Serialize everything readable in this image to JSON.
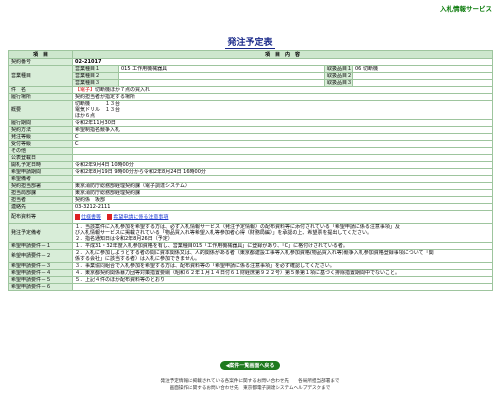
{
  "header": {
    "service_name": "入札情報サービス"
  },
  "page_title": "発注予定表",
  "table_header": {
    "item": "項　目",
    "content": "項　目　内　容"
  },
  "rows": {
    "contract_no": {
      "label": "契約番号",
      "value": "02-21017"
    },
    "business_type": {
      "label": "営業種目",
      "sub1_label": "営業種目１",
      "sub1_value": "015 工作用機械器具",
      "sub2_label": "営業種目２",
      "sub2_value": "",
      "sub3_label": "営業種目３",
      "sub3_value": "",
      "item1_label": "取扱品目１",
      "item1_value": "06 切断機",
      "item2_label": "取扱品目２",
      "item2_value": "",
      "item3_label": "取扱品目３",
      "item3_value": ""
    },
    "subject": {
      "label": "件　名",
      "tag": "【電子】",
      "value": "切断機ほか７点の買入れ"
    },
    "delivery_place": {
      "label": "履行場所",
      "value": "契約担当者が指定する場所"
    },
    "summary": {
      "label": "概要",
      "lines": [
        "切断機　　　１３台",
        "電気ドリル　１３台",
        "ほか６点"
      ]
    },
    "scheduled_date": {
      "label": "履行期間",
      "value": "令和2年11月30日"
    },
    "contract_method": {
      "label": "契約方法",
      "value": "希望制指名競争入札"
    },
    "dev_grade": {
      "label": "発注等級",
      "value": "C"
    },
    "accept_grade": {
      "label": "受付等級",
      "value": "C"
    },
    "other": {
      "label": "その他",
      "value": ""
    },
    "registration_date": {
      "label": "公表登載日",
      "value": ""
    },
    "opening_date": {
      "label": "開札予定日時",
      "value": "令和2年9月4日 10時00分"
    },
    "apply_period": {
      "label": "希望申請期間",
      "value": "令和2年8月19日 9時00分から令和2年8月24日 16時00分"
    },
    "bid_remarks": {
      "label": "希望備考",
      "value": ""
    },
    "contract_dept": {
      "label": "契約担当部署",
      "value": "東京消防庁総務部経理契約課（電子調達システム）"
    },
    "charge_dept": {
      "label": "担当局部課",
      "value": "東京消防庁総務部経理契約課"
    },
    "person": {
      "label": "担当者",
      "value": "契約係　坂部"
    },
    "contact": {
      "label": "連絡先",
      "value": "03-3212-2111"
    },
    "docs": {
      "label": "配布資料等",
      "link1": "仕様書等",
      "link2": "希望申請に係る注意事項"
    },
    "order_notes": {
      "label": "発注予定備考",
      "lines": [
        "１．当該案件に入札参加を希望する方は、必ず入札情報サービス（発注予定情報）の配布資料等に添付されている「希望申請に係る注意事項」及",
        "び入札情報サービスに掲載されている「物品買入れ等希望入札等参加者心得（財務局編）」を承認の上、希望票を提出してください。",
        "２．指名通知日は令和2年8月26日（予定）"
      ]
    },
    "cond1": {
      "label": "希望申請要件－１",
      "value": "１．平成31・32年度入札参加資格を有し、営業種目015「工作用機械器具」に登録があり、「C」に格付けされている者。"
    },
    "cond2": {
      "label": "希望申請要件－２",
      "lines": [
        "２．入札に参加しようとする者の間に資本関係又は、人的関係がある者（東京都建設工事等入札参加資格(物品買入れ等)競争入札参加資格登録事項について「関",
        "係する会社」に該当する者）は入札に参加できません。"
      ]
    },
    "cond3": {
      "label": "希望申請要件－３",
      "value": "３．事業協同組合で入札参加を希望する方は、配布資料等の「希望申請に係る注意事項」を必ず確認してください。"
    },
    "cond4": {
      "label": "希望申請要件－４",
      "value": "４．東京都契約関係暴力団等対策措置要綱（昭和６２年１月１４日付６１財経庶第９２２号）第５条第１項に基づく排除措置期間中でないこと。"
    },
    "cond5": {
      "label": "希望申請要件－５",
      "value": "５．上記４件のほか配布資料等のとおり"
    },
    "cond6": {
      "label": "希望申請要件－６",
      "value": ""
    }
  },
  "back_button": "◀案件一覧画面へ戻る",
  "footer": {
    "line1": "発注予定情報に掲載されている各案件に関するお問い合わせ先　　各局所担当部署まで",
    "line2": "画面操作に関するお問い合わせ先　東京都電子調達システムヘルプデスクまで"
  }
}
